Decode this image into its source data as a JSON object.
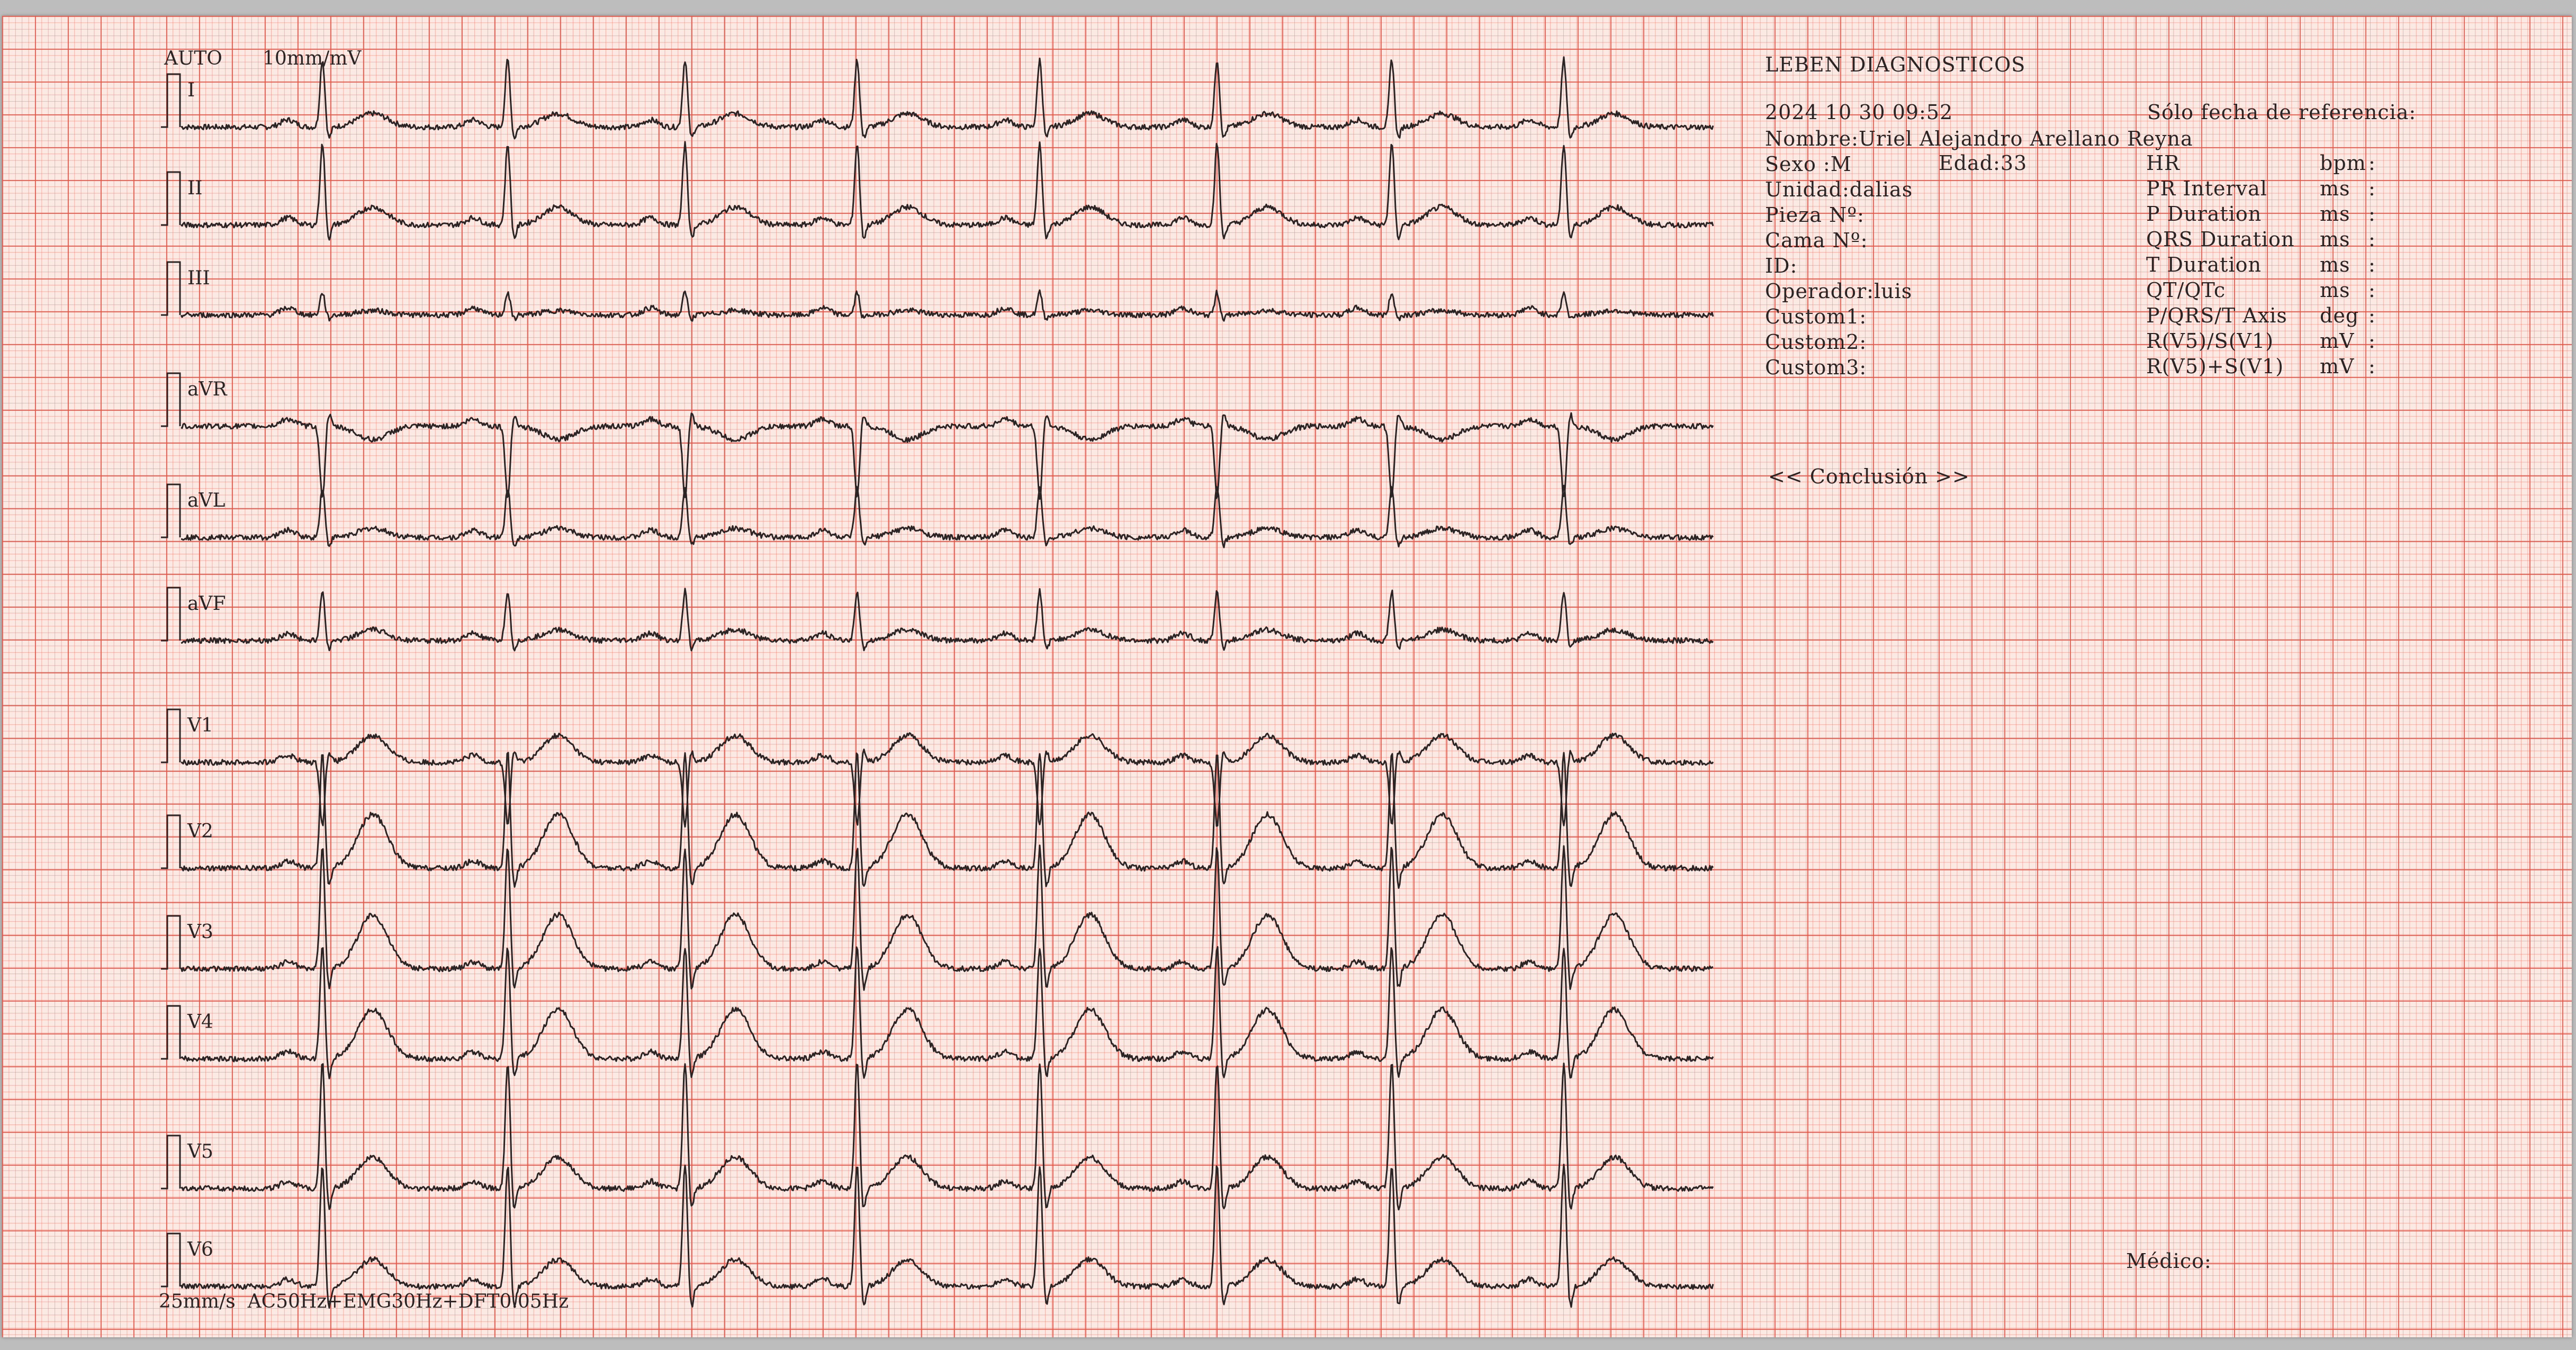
{
  "gain_label": "AUTO",
  "sensitivity": "10mm/mV",
  "footer": "25mm/s  AC50Hz+EMG30Hz+DFT0.05Hz",
  "leads": [
    "I",
    "II",
    "III",
    "aVR",
    "aVL",
    "aVF",
    "V1",
    "V2",
    "V3",
    "V4",
    "V5",
    "V6"
  ],
  "header": {
    "company": "LEBEN DIAGNOSTICOS",
    "datetime": "2024 10 30 09:52",
    "reference_note": "Sólo fecha de referencia:",
    "fields": [
      "Nombre:Uriel Alejandro Arellano Reyna",
      "Sexo :M",
      "Unidad:dalias",
      "Pieza Nº:",
      "Cama Nº:",
      "ID:",
      "Operador:luis",
      "Custom1:",
      "Custom2:",
      "Custom3:"
    ],
    "age": "Edad:33"
  },
  "measurements": [
    {
      "label": "HR",
      "unit": "bpm",
      "sep": ":"
    },
    {
      "label": "PR Interval",
      "unit": "ms",
      "sep": ":"
    },
    {
      "label": "P Duration",
      "unit": "ms",
      "sep": ":"
    },
    {
      "label": "QRS Duration",
      "unit": "ms",
      "sep": ":"
    },
    {
      "label": "T Duration",
      "unit": "ms",
      "sep": ":"
    },
    {
      "label": "QT/QTc",
      "unit": "ms",
      "sep": ":"
    },
    {
      "label": "P/QRS/T Axis",
      "unit": "deg",
      "sep": ":"
    },
    {
      "label": "R(V5)/S(V1)",
      "unit": "mV",
      "sep": ":"
    },
    {
      "label": "R(V5)+S(V1)",
      "unit": "mV",
      "sep": ":"
    }
  ],
  "conclusion_label": "<< Conclusión >>",
  "doctor_label": "Médico:",
  "colors": {
    "grid": "#eb5546",
    "paper": "#fbe9e4",
    "trace": "#2a2424"
  }
}
